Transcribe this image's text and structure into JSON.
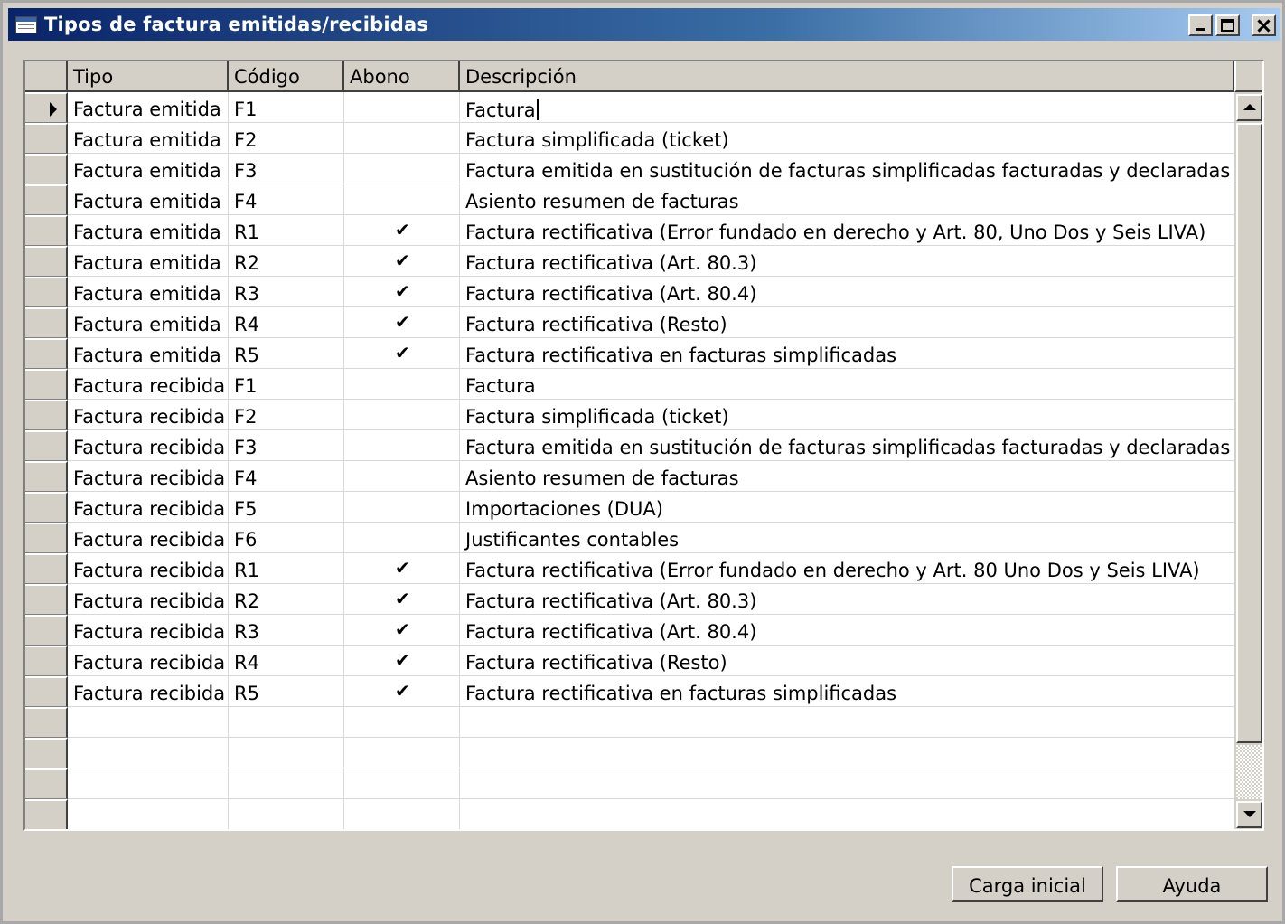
{
  "window": {
    "title": "Tipos de factura emitidas/recibidas",
    "icon": "table-icon"
  },
  "columns": [
    "Tipo",
    "Código",
    "Abono",
    "Descripción"
  ],
  "rows": [
    {
      "tipo": "Factura emitida",
      "codigo": "F1",
      "abono": false,
      "descripcion": "Factura"
    },
    {
      "tipo": "Factura emitida",
      "codigo": "F2",
      "abono": false,
      "descripcion": "Factura simplificada (ticket)"
    },
    {
      "tipo": "Factura emitida",
      "codigo": "F3",
      "abono": false,
      "descripcion": "Factura emitida en sustitución de facturas simplificadas facturadas y declaradas"
    },
    {
      "tipo": "Factura emitida",
      "codigo": "F4",
      "abono": false,
      "descripcion": "Asiento resumen de facturas"
    },
    {
      "tipo": "Factura emitida",
      "codigo": "R1",
      "abono": true,
      "descripcion": "Factura rectificativa (Error fundado en derecho y Art. 80, Uno Dos y Seis LIVA)"
    },
    {
      "tipo": "Factura emitida",
      "codigo": "R2",
      "abono": true,
      "descripcion": "Factura rectificativa (Art. 80.3)"
    },
    {
      "tipo": "Factura emitida",
      "codigo": "R3",
      "abono": true,
      "descripcion": "Factura rectificativa (Art. 80.4)"
    },
    {
      "tipo": "Factura emitida",
      "codigo": "R4",
      "abono": true,
      "descripcion": "Factura rectificativa (Resto)"
    },
    {
      "tipo": "Factura emitida",
      "codigo": "R5",
      "abono": true,
      "descripcion": "Factura rectificativa en facturas simplificadas"
    },
    {
      "tipo": "Factura recibida",
      "codigo": "F1",
      "abono": false,
      "descripcion": "Factura"
    },
    {
      "tipo": "Factura recibida",
      "codigo": "F2",
      "abono": false,
      "descripcion": "Factura simplificada (ticket)"
    },
    {
      "tipo": "Factura recibida",
      "codigo": "F3",
      "abono": false,
      "descripcion": "Factura emitida en sustitución de facturas simplificadas facturadas y declaradas"
    },
    {
      "tipo": "Factura recibida",
      "codigo": "F4",
      "abono": false,
      "descripcion": "Asiento resumen de facturas"
    },
    {
      "tipo": "Factura recibida",
      "codigo": "F5",
      "abono": false,
      "descripcion": "Importaciones (DUA)"
    },
    {
      "tipo": "Factura recibida",
      "codigo": "F6",
      "abono": false,
      "descripcion": "Justificantes contables"
    },
    {
      "tipo": "Factura recibida",
      "codigo": "R1",
      "abono": true,
      "descripcion": "Factura rectificativa (Error fundado en derecho y Art. 80 Uno Dos y Seis LIVA)"
    },
    {
      "tipo": "Factura recibida",
      "codigo": "R2",
      "abono": true,
      "descripcion": "Factura rectificativa (Art. 80.3)"
    },
    {
      "tipo": "Factura recibida",
      "codigo": "R3",
      "abono": true,
      "descripcion": "Factura rectificativa (Art. 80.4)"
    },
    {
      "tipo": "Factura recibida",
      "codigo": "R4",
      "abono": true,
      "descripcion": "Factura rectificativa (Resto)"
    },
    {
      "tipo": "Factura recibida",
      "codigo": "R5",
      "abono": true,
      "descripcion": "Factura rectificativa en facturas simplificadas"
    }
  ],
  "current_row": 0,
  "empty_rows": 4,
  "check_glyph": "✔",
  "buttons": {
    "carga": "Carga inicial",
    "ayuda": "Ayuda"
  }
}
